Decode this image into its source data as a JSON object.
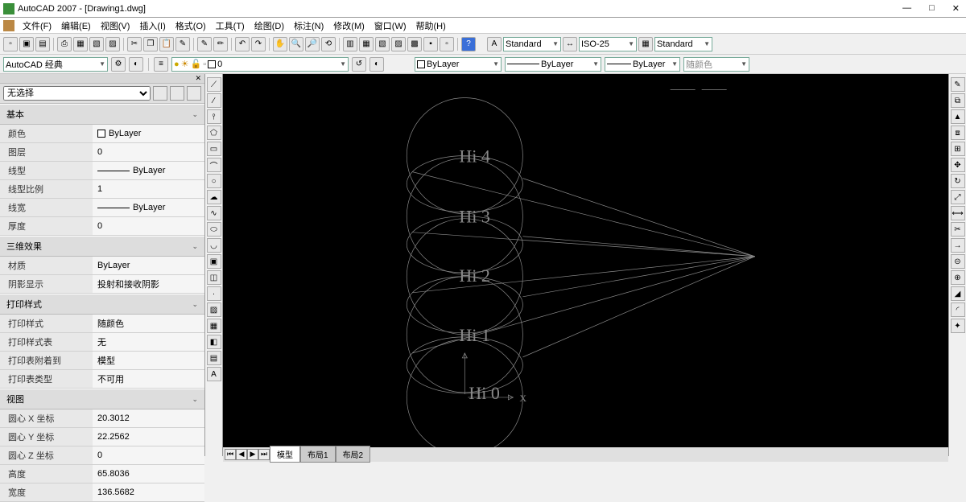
{
  "title": "AutoCAD 2007 - [Drawing1.dwg]",
  "menus": [
    "文件(F)",
    "编辑(E)",
    "视图(V)",
    "插入(I)",
    "格式(O)",
    "工具(T)",
    "绘图(D)",
    "标注(N)",
    "修改(M)",
    "窗口(W)",
    "帮助(H)"
  ],
  "topcombos": {
    "textStyle": "Standard",
    "dimStyle": "ISO-25",
    "tableStyle": "Standard"
  },
  "workspace": "AutoCAD 经典",
  "layer": "0",
  "bylayer": "ByLayer",
  "colorcombo": "随颜色",
  "props": {
    "noSelect": "无选择",
    "sections": {
      "basic": "基本",
      "threeD": "三维效果",
      "print": "打印样式",
      "view": "视图"
    },
    "basic": {
      "color_l": "颜色",
      "color_v": "ByLayer",
      "layer_l": "图层",
      "layer_v": "0",
      "ltype_l": "线型",
      "ltype_v": "ByLayer",
      "ltscale_l": "线型比例",
      "ltscale_v": "1",
      "lweight_l": "线宽",
      "lweight_v": "ByLayer",
      "thick_l": "厚度",
      "thick_v": "0"
    },
    "threeD": {
      "mat_l": "材质",
      "mat_v": "ByLayer",
      "shadow_l": "阴影显示",
      "shadow_v": "投射和接收阴影"
    },
    "print": {
      "pstyle_l": "打印样式",
      "pstyle_v": "随颜色",
      "ptable_l": "打印样式表",
      "ptable_v": "无",
      "pattach_l": "打印表附着到",
      "pattach_v": "模型",
      "ptype_l": "打印表类型",
      "ptype_v": "不可用"
    },
    "view": {
      "cx_l": "圆心 X 坐标",
      "cx_v": "20.3012",
      "cy_l": "圆心 Y 坐标",
      "cy_v": "22.2562",
      "cz_l": "圆心 Z 坐标",
      "cz_v": "0",
      "h_l": "高度",
      "h_v": "65.8036",
      "w_l": "宽度",
      "w_v": "136.5682"
    }
  },
  "tabs": {
    "model": "模型",
    "layout1": "布局1",
    "layout2": "布局2"
  },
  "canvas_labels": {
    "h0": "Hi 0",
    "h1": "Hi 1",
    "h2": "Hi 2",
    "h3": "Hi 3",
    "h4": "Hi 4",
    "x": "X"
  }
}
